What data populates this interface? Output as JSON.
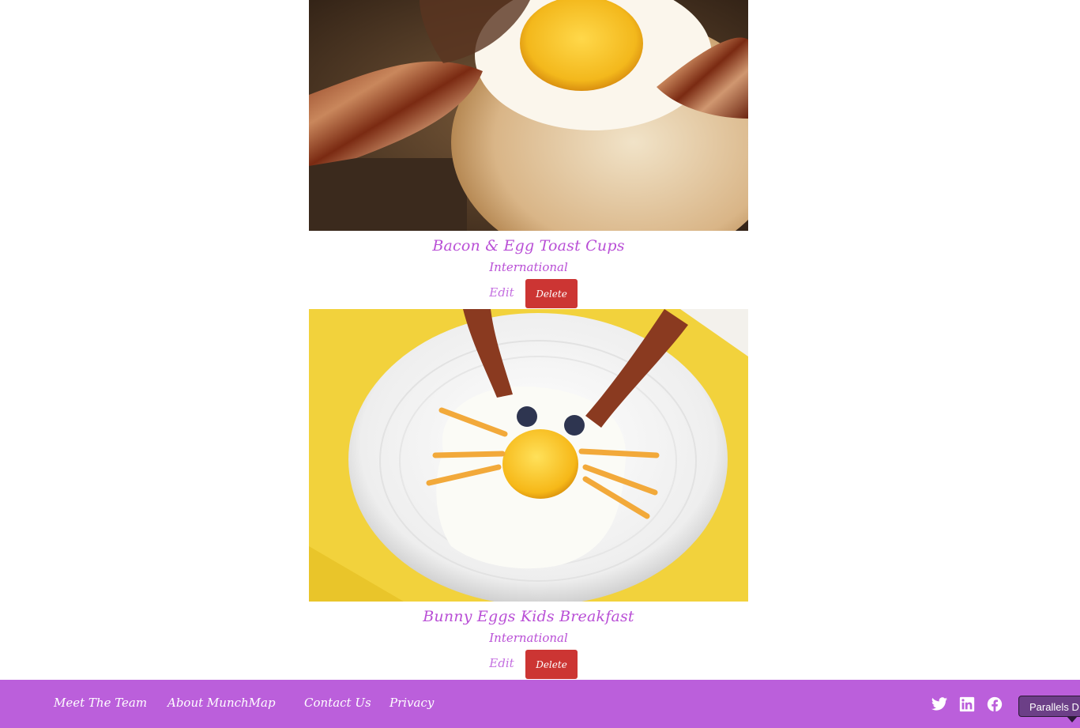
{
  "recipes": [
    {
      "title": "Bacon & Egg Toast Cups",
      "cuisine": "International",
      "edit_label": "Edit",
      "delete_label": "Delete"
    },
    {
      "title": "Bunny Eggs Kids Breakfast",
      "cuisine": "International",
      "edit_label": "Edit",
      "delete_label": "Delete"
    }
  ],
  "footer": {
    "links": [
      "Meet The Team",
      "About MunchMap",
      "Contact Us",
      "Privacy"
    ],
    "social_icons": [
      "twitter-icon",
      "linkedin-icon",
      "facebook-icon"
    ]
  },
  "tooltip": {
    "text": "Parallels D"
  },
  "colors": {
    "accent": "#b94fd6",
    "footer_bg": "#bb5fdb",
    "delete_bg": "#cc3533"
  }
}
